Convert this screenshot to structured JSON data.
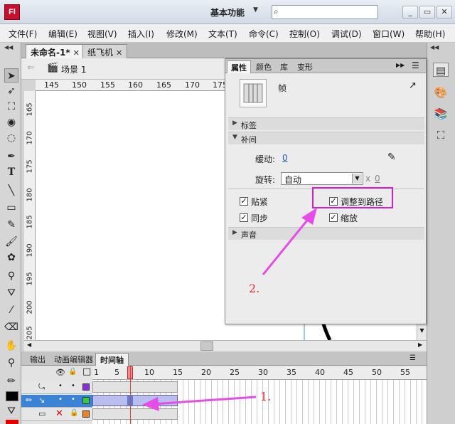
{
  "titlebar": {
    "logo": "Fl",
    "workspace": "基本功能",
    "workspace_arrow": "▼",
    "search_icon": "⌕",
    "search_placeholder": "",
    "minimize": "_",
    "maximize": "▭",
    "close": "✕"
  },
  "menu": {
    "items": [
      "文件(F)",
      "编辑(E)",
      "视图(V)",
      "插入(I)",
      "修改(M)",
      "文本(T)",
      "命令(C)",
      "控制(O)",
      "调试(D)",
      "窗口(W)",
      "帮助(H)"
    ]
  },
  "documents": {
    "tabs": [
      {
        "label": "未命名-1*",
        "close": "✕"
      },
      {
        "label": "纸飞机",
        "close": "✕"
      }
    ],
    "collapse": "◀◀"
  },
  "scene": {
    "back": "⇐",
    "label": "场景 1"
  },
  "rulers": {
    "h": [
      "145",
      "150",
      "155",
      "160",
      "165",
      "170",
      "175"
    ],
    "v": [
      "165",
      "170",
      "175",
      "180",
      "185",
      "190",
      "195",
      "200",
      "205"
    ]
  },
  "timeline": {
    "tabs": [
      "输出",
      "动画编辑器",
      "时间轴"
    ],
    "frame_numbers": [
      "1",
      "5",
      "10",
      "15",
      "20",
      "25",
      "30",
      "35",
      "40",
      "45",
      "50",
      "55"
    ],
    "header_icons": {
      "eye": "👁",
      "lock": "🔒",
      "outline": "□"
    },
    "collapse": "◀◀"
  },
  "properties": {
    "tabs": [
      "属性",
      "颜色",
      "库",
      "变形"
    ],
    "frame_label": "帧",
    "sections": {
      "label": "标签",
      "tween": "补间",
      "sound": "声音"
    },
    "ease_label": "缓动:",
    "ease_value": "0",
    "rotate_label": "旋转:",
    "rotate_value": "自动",
    "rotate_times_label": "x",
    "rotate_times_value": "0",
    "checkboxes": [
      {
        "label": "贴紧",
        "checked": true
      },
      {
        "label": "调整到路径",
        "checked": true
      },
      {
        "label": "同步",
        "checked": true
      },
      {
        "label": "缩放",
        "checked": true
      }
    ]
  },
  "annotations": {
    "one": "1.",
    "two": "2."
  },
  "colors": {
    "highlight": "#d020d0",
    "annotation": "#e03030",
    "arrow": "#e64de6",
    "playhead": "#e04040"
  }
}
